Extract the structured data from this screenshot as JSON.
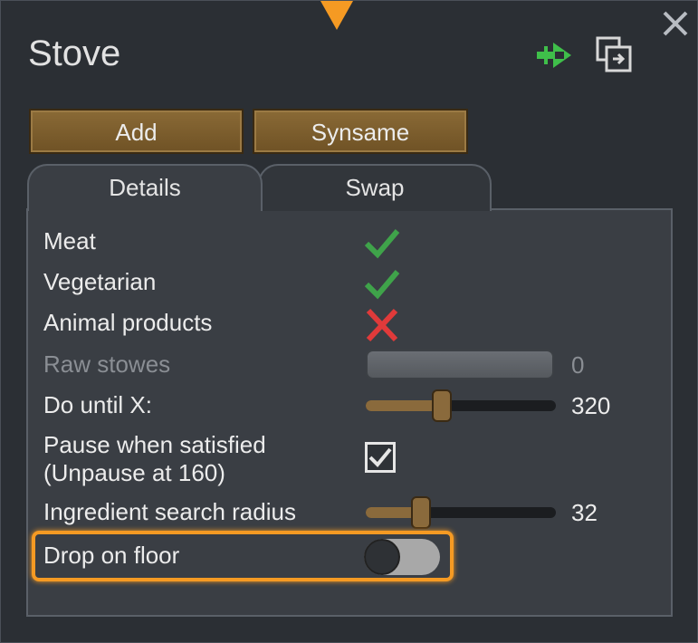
{
  "window": {
    "title": "Stove",
    "icons": [
      "rename-icon",
      "copy-icon",
      "close-icon"
    ]
  },
  "toolbar": {
    "add_label": "Add",
    "synsame_label": "Synsame"
  },
  "tabs": [
    {
      "label": "Details",
      "active": true
    },
    {
      "label": "Swap",
      "active": false
    }
  ],
  "details": {
    "meat": {
      "label": "Meat",
      "allowed": true
    },
    "vegetarian": {
      "label": "Vegetarian",
      "allowed": true
    },
    "animal_products": {
      "label": "Animal products",
      "allowed": false
    },
    "raw_stowes": {
      "label": "Raw stowes",
      "value": "0",
      "enabled": false
    },
    "do_until": {
      "label": "Do until X:",
      "value": "320",
      "slider_fraction": 0.4
    },
    "pause_line1": "Pause when satisfied",
    "pause_line2": "(Unpause at 160)",
    "pause_checked": true,
    "search_radius": {
      "label": "Ingredient search radius",
      "value": "32",
      "slider_fraction": 0.29
    },
    "drop_on_floor": {
      "label": "Drop on floor",
      "on": false
    }
  },
  "colors": {
    "accent": "#f59a23",
    "check": "#3fa34a",
    "cross": "#e03a3a",
    "button": "#8a6a36"
  }
}
